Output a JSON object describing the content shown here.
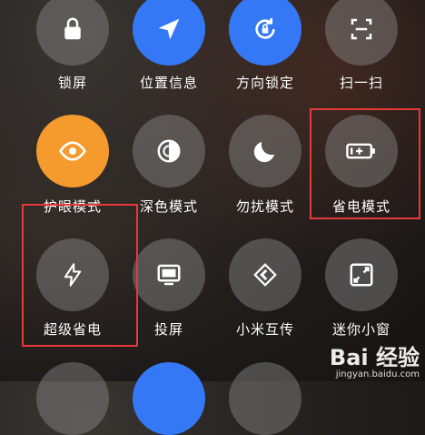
{
  "row1": [
    {
      "label": "锁屏",
      "icon": "lock-icon",
      "state": "off"
    },
    {
      "label": "位置信息",
      "icon": "location-arrow-icon",
      "state": "on"
    },
    {
      "label": "方向锁定",
      "icon": "rotation-lock-icon",
      "state": "on"
    },
    {
      "label": "扫一扫",
      "icon": "scan-icon",
      "state": "off"
    }
  ],
  "row2": [
    {
      "label": "护眼模式",
      "icon": "eye-icon",
      "state": "on"
    },
    {
      "label": "深色模式",
      "icon": "dark-mode-icon",
      "state": "off"
    },
    {
      "label": "勿扰模式",
      "icon": "moon-icon",
      "state": "off"
    },
    {
      "label": "省电模式",
      "icon": "battery-icon",
      "state": "off"
    }
  ],
  "row3": [
    {
      "label": "超级省电",
      "icon": "lightning-icon",
      "state": "off"
    },
    {
      "label": "投屏",
      "icon": "cast-screen-icon",
      "state": "off"
    },
    {
      "label": "小米互传",
      "icon": "mi-share-icon",
      "state": "off"
    },
    {
      "label": "迷你小窗",
      "icon": "mini-window-icon",
      "state": "off"
    }
  ],
  "watermark": {
    "brand": "Bai 经验",
    "url": "jingyan.baidu.com"
  },
  "colors": {
    "accent_blue": "#3478f6",
    "accent_orange": "#f59a2c",
    "highlight_red": "#e43a3a",
    "tile_off": "rgba(140,140,140,0.45)"
  }
}
